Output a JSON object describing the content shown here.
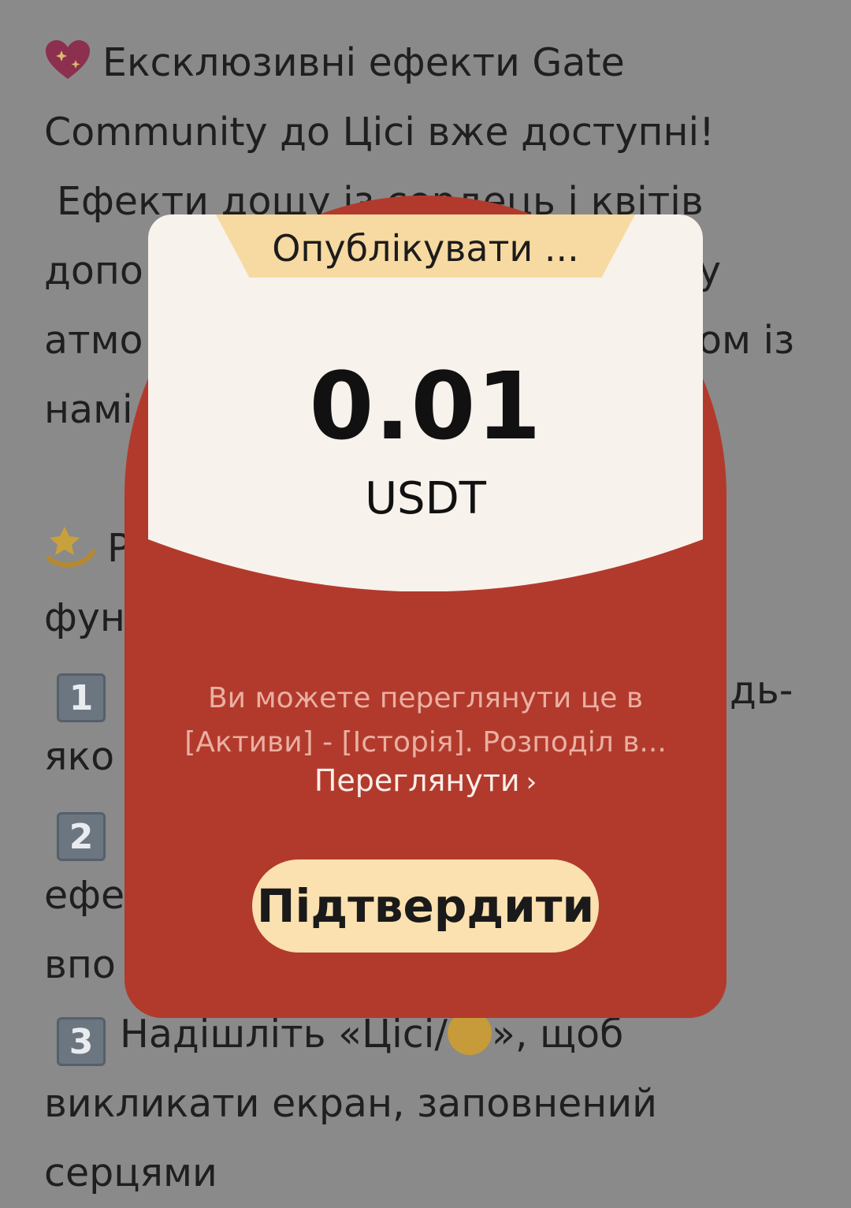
{
  "article": {
    "lines": [
      "Ексклюзивні ефекти Gate",
      "Community до Цісі вже доступні!",
      "Ефекти дощу із сердець і квітів",
      "допо",
      "атмо",
      "намі",
      "Р",
      "фун",
      "дь-",
      "яко",
      "ефе",
      "впо",
      "Надішліть «Цісі/",
      "», щоб",
      "викликати екран, заповнений",
      "серцями"
    ],
    "partial_right_1": "у",
    "partial_right_2": "ом із",
    "keycaps": [
      "1",
      "2",
      "3"
    ]
  },
  "modal": {
    "tab_title": "Опублікувати ...",
    "amount": "0.01",
    "currency": "USDT",
    "info_line1": "Ви можете переглянути це в",
    "info_line2": "[Активи] - [Історія]. Розподіл в...",
    "view_label": "Переглянути",
    "view_chevron": "›",
    "confirm_label": "Підтвердити"
  },
  "colors": {
    "envelope": "#b23a2c",
    "card": "#f8f2ec",
    "tab": "#f7d9a2",
    "button": "#fbe0b0",
    "overlay": "#8a8a8a"
  }
}
